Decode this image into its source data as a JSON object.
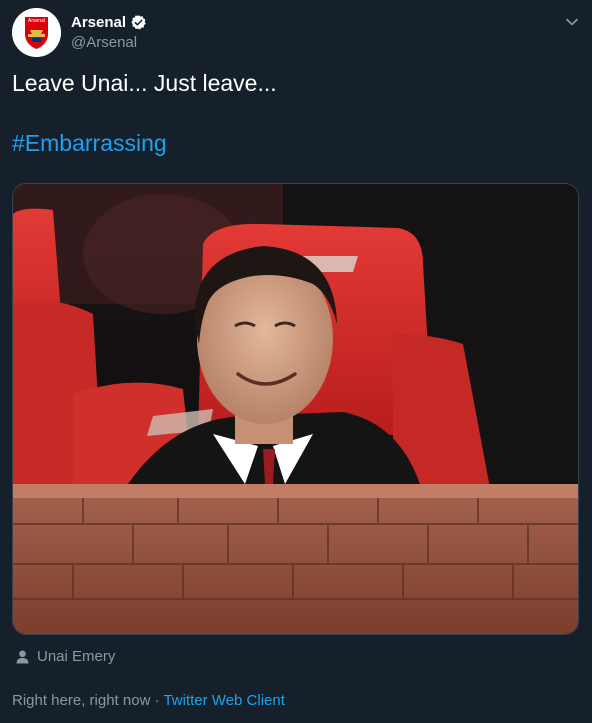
{
  "author": {
    "name": "Arsenal",
    "handle": "@Arsenal",
    "avatar_badge_text": "Arsenal",
    "verified": true
  },
  "tweet": {
    "text": "Leave Unai... Just leave...",
    "hashtag": "#Embarrassing"
  },
  "media": {
    "tagged_person": "Unai Emery"
  },
  "footer": {
    "time": "Right here, right now",
    "separator": " · ",
    "client": "Twitter Web Client"
  },
  "icons": {
    "more": "chevron-down-icon",
    "verified": "verified-badge-icon",
    "tag": "person-icon"
  },
  "colors": {
    "background": "#15202b",
    "link": "#1da1f2",
    "muted": "#8899a6",
    "border": "#38444d"
  }
}
